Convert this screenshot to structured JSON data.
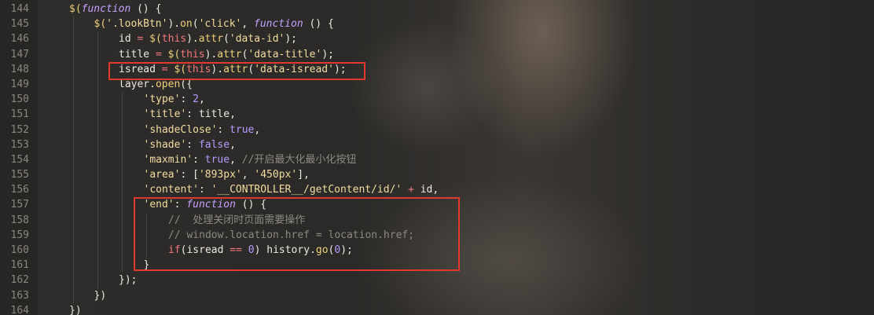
{
  "editor": {
    "lines": [
      {
        "n": "144",
        "indent": 0,
        "tokens": [
          [
            "fn",
            "$("
          ],
          [
            "kw",
            "function"
          ],
          [
            "plain",
            " () {"
          ]
        ]
      },
      {
        "n": "145",
        "indent": 1,
        "tokens": [
          [
            "fn",
            "$("
          ],
          [
            "str",
            "'.lookBtn'"
          ],
          [
            "plain",
            ")."
          ],
          [
            "fn",
            "on"
          ],
          [
            "plain",
            "("
          ],
          [
            "str",
            "'click'"
          ],
          [
            "plain",
            ", "
          ],
          [
            "kw",
            "function"
          ],
          [
            "plain",
            " () {"
          ]
        ]
      },
      {
        "n": "146",
        "indent": 2,
        "tokens": [
          [
            "plain",
            "id "
          ],
          [
            "op",
            "="
          ],
          [
            "plain",
            " "
          ],
          [
            "fn",
            "$("
          ],
          [
            "this",
            "this"
          ],
          [
            "plain",
            ")."
          ],
          [
            "fn",
            "attr"
          ],
          [
            "plain",
            "("
          ],
          [
            "str",
            "'data-id'"
          ],
          [
            "plain",
            ");"
          ]
        ]
      },
      {
        "n": "147",
        "indent": 2,
        "tokens": [
          [
            "plain",
            "title "
          ],
          [
            "op",
            "="
          ],
          [
            "plain",
            " "
          ],
          [
            "fn",
            "$("
          ],
          [
            "this",
            "this"
          ],
          [
            "plain",
            ")."
          ],
          [
            "fn",
            "attr"
          ],
          [
            "plain",
            "("
          ],
          [
            "str",
            "'data-title'"
          ],
          [
            "plain",
            ");"
          ]
        ]
      },
      {
        "n": "148",
        "indent": 2,
        "tokens": [
          [
            "plain",
            "isread "
          ],
          [
            "op",
            "="
          ],
          [
            "plain",
            " "
          ],
          [
            "fn",
            "$("
          ],
          [
            "this",
            "this"
          ],
          [
            "plain",
            ")."
          ],
          [
            "fn",
            "attr"
          ],
          [
            "plain",
            "("
          ],
          [
            "str",
            "'data-isread'"
          ],
          [
            "plain",
            ");"
          ]
        ]
      },
      {
        "n": "149",
        "indent": 2,
        "tokens": [
          [
            "plain",
            "layer."
          ],
          [
            "fn",
            "open"
          ],
          [
            "plain",
            "({"
          ]
        ]
      },
      {
        "n": "150",
        "indent": 3,
        "tokens": [
          [
            "str",
            "'type'"
          ],
          [
            "plain",
            ": "
          ],
          [
            "num",
            "2"
          ],
          [
            "plain",
            ","
          ]
        ]
      },
      {
        "n": "151",
        "indent": 3,
        "tokens": [
          [
            "str",
            "'title'"
          ],
          [
            "plain",
            ": title,"
          ]
        ]
      },
      {
        "n": "152",
        "indent": 3,
        "tokens": [
          [
            "str",
            "'shadeClose'"
          ],
          [
            "plain",
            ": "
          ],
          [
            "num",
            "true"
          ],
          [
            "plain",
            ","
          ]
        ]
      },
      {
        "n": "153",
        "indent": 3,
        "tokens": [
          [
            "str",
            "'shade'"
          ],
          [
            "plain",
            ": "
          ],
          [
            "num",
            "false"
          ],
          [
            "plain",
            ","
          ]
        ]
      },
      {
        "n": "154",
        "indent": 3,
        "tokens": [
          [
            "str",
            "'maxmin'"
          ],
          [
            "plain",
            ": "
          ],
          [
            "num",
            "true"
          ],
          [
            "plain",
            ", "
          ],
          [
            "cm",
            "//开启最大化最小化按钮"
          ]
        ]
      },
      {
        "n": "155",
        "indent": 3,
        "tokens": [
          [
            "str",
            "'area'"
          ],
          [
            "plain",
            ": ["
          ],
          [
            "str",
            "'893px'"
          ],
          [
            "plain",
            ", "
          ],
          [
            "str",
            "'450px'"
          ],
          [
            "plain",
            "],"
          ]
        ]
      },
      {
        "n": "156",
        "indent": 3,
        "tokens": [
          [
            "str",
            "'content'"
          ],
          [
            "plain",
            ": "
          ],
          [
            "str",
            "'__CONTROLLER__/getContent/id/'"
          ],
          [
            "plain",
            " "
          ],
          [
            "op",
            "+"
          ],
          [
            "plain",
            " id,"
          ]
        ]
      },
      {
        "n": "157",
        "indent": 3,
        "tokens": [
          [
            "str",
            "'end'"
          ],
          [
            "plain",
            ": "
          ],
          [
            "kw",
            "function"
          ],
          [
            "plain",
            " () {"
          ]
        ]
      },
      {
        "n": "158",
        "indent": 4,
        "tokens": [
          [
            "cm",
            "//  处理关闭时页面需要操作"
          ]
        ]
      },
      {
        "n": "159",
        "indent": 4,
        "tokens": [
          [
            "cm",
            "// window.location.href = location.href;"
          ]
        ]
      },
      {
        "n": "160",
        "indent": 4,
        "tokens": [
          [
            "op",
            "if"
          ],
          [
            "plain",
            "(isread "
          ],
          [
            "op",
            "=="
          ],
          [
            "plain",
            " "
          ],
          [
            "num",
            "0"
          ],
          [
            "plain",
            ") history."
          ],
          [
            "fn",
            "go"
          ],
          [
            "plain",
            "("
          ],
          [
            "num",
            "0"
          ],
          [
            "plain",
            ");"
          ]
        ]
      },
      {
        "n": "161",
        "indent": 3,
        "tokens": [
          [
            "plain",
            "}"
          ]
        ]
      },
      {
        "n": "162",
        "indent": 2,
        "tokens": [
          [
            "plain",
            "});"
          ]
        ]
      },
      {
        "n": "163",
        "indent": 1,
        "tokens": [
          [
            "plain",
            "})"
          ]
        ]
      },
      {
        "n": "164",
        "indent": 0,
        "tokens": [
          [
            "plain",
            "})"
          ]
        ]
      }
    ],
    "highlight_color": "#e03a2f"
  }
}
